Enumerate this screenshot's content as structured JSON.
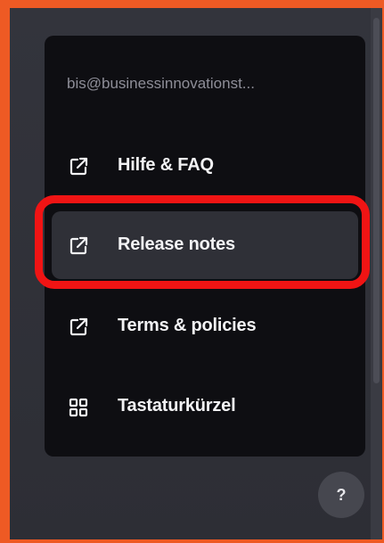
{
  "menu": {
    "email": "bis@businessinnovationst...",
    "items": [
      {
        "label": "Hilfe & FAQ",
        "icon": "external-link-icon"
      },
      {
        "label": "Release notes",
        "icon": "external-link-icon"
      },
      {
        "label": "Terms & policies",
        "icon": "external-link-icon"
      },
      {
        "label": "Tastaturkürzel",
        "icon": "keyboard-grid-icon"
      }
    ]
  },
  "help_button": {
    "label": "?"
  },
  "colors": {
    "frame": "#ee5a24",
    "highlight": "#f01414",
    "menu_background": "#0e0e12",
    "selected_item": "#2f3037",
    "page_background": "#2b2c33"
  }
}
